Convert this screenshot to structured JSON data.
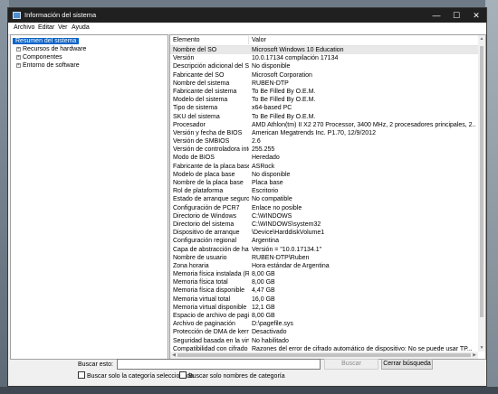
{
  "window": {
    "title": "Información del sistema",
    "controls": {
      "minimize": "—",
      "maximize": "☐",
      "close": "✕"
    }
  },
  "menu": [
    "Archivo",
    "Editar",
    "Ver",
    "Ayuda"
  ],
  "tree": {
    "root": "Resumen del sistema",
    "children": [
      "Recursos de hardware",
      "Componentes",
      "Entorno de software"
    ],
    "expander_glyph": "+"
  },
  "list": {
    "columns": [
      "Elemento",
      "Valor"
    ],
    "rows": [
      [
        "Nombre del SO",
        "Microsoft Windows 10 Education"
      ],
      [
        "Versión",
        "10.0.17134 compilación 17134"
      ],
      [
        "Descripción adicional del SO",
        "No disponible"
      ],
      [
        "Fabricante del SO",
        "Microsoft Corporation"
      ],
      [
        "Nombre del sistema",
        "RUBEN-DTP"
      ],
      [
        "Fabricante del sistema",
        "To Be Filled By O.E.M."
      ],
      [
        "Modelo del sistema",
        "To Be Filled By O.E.M."
      ],
      [
        "Tipo de sistema",
        "x64-based PC"
      ],
      [
        "SKU del sistema",
        "To Be Filled By O.E.M."
      ],
      [
        "Procesador",
        "AMD Athlon(tm) II X2 270 Processor, 3400 MHz, 2 procesadores principales, 2..."
      ],
      [
        "Versión y fecha de BIOS",
        "American Megatrends Inc. P1.70, 12/9/2012"
      ],
      [
        "Versión de SMBIOS",
        "2.6"
      ],
      [
        "Versión de controladora integ",
        "255.255"
      ],
      [
        "Modo de BIOS",
        "Heredado"
      ],
      [
        "Fabricante de la placa base",
        "ASRock"
      ],
      [
        "Modelo de placa base",
        "No disponible"
      ],
      [
        "Nombre de la placa base",
        "Placa base"
      ],
      [
        "Rol de plataforma",
        "Escritorio"
      ],
      [
        "Estado de arranque seguro",
        "No compatible"
      ],
      [
        "Configuración de PCR7",
        "Enlace no posible"
      ],
      [
        "Directorio de Windows",
        "C:\\WINDOWS"
      ],
      [
        "Directorio del sistema",
        "C:\\WINDOWS\\system32"
      ],
      [
        "Dispositivo de arranque",
        "\\Device\\HarddiskVolume1"
      ],
      [
        "Configuración regional",
        "Argentina"
      ],
      [
        "Capa de abstracción de hardw",
        "Versión = \"10.0.17134.1\""
      ],
      [
        "Nombre de usuario",
        "RUBEN-DTP\\Ruben"
      ],
      [
        "Zona horaria",
        "Hora estándar de Argentina"
      ],
      [
        "Memoria física instalada (RAM)",
        "8,00 GB"
      ],
      [
        "Memoria física total",
        "8,00 GB"
      ],
      [
        "Memoria física disponible",
        "4,47 GB"
      ],
      [
        "Memoria virtual total",
        "16,0 GB"
      ],
      [
        "Memoria virtual disponible",
        "12,1 GB"
      ],
      [
        "Espacio de archivo de paginaci",
        "8,00 GB"
      ],
      [
        "Archivo de paginación",
        "D:\\pagefile.sys"
      ],
      [
        "Protección de DMA de kernel",
        "Desactivado"
      ],
      [
        "Seguridad basada en la virtual",
        "No habilitado"
      ],
      [
        "Compatibilidad con cifrado de ...",
        "Razones del error de cifrado automático de dispositivo: No se puede usar TP..."
      ]
    ]
  },
  "search": {
    "label": "Buscar esto:",
    "value": "",
    "find_button": "Buscar",
    "close_button": "Cerrar búsqueda",
    "option_category": "Buscar solo la categoría seleccionada",
    "option_names": "Buscar solo nombres de categoría"
  },
  "colors": {
    "selection": "#0a64c8",
    "titlebar": "#202020"
  },
  "icons": [
    "app-icon",
    "expander-plus-icon",
    "scroll-up-arrow-icon",
    "scroll-down-arrow-icon",
    "scroll-left-arrow-icon",
    "scroll-right-arrow-icon"
  ]
}
